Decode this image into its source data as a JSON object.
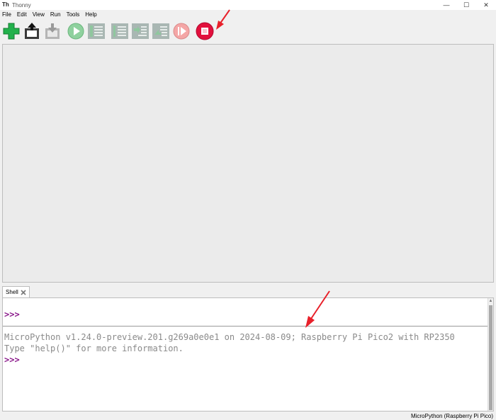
{
  "window": {
    "title": "Thonny",
    "app_icon_text": "Th",
    "controls": {
      "minimize": "—",
      "maximize": "☐",
      "close": "✕"
    }
  },
  "menu": [
    {
      "label": "File"
    },
    {
      "label": "Edit"
    },
    {
      "label": "View"
    },
    {
      "label": "Run"
    },
    {
      "label": "Tools"
    },
    {
      "label": "Help"
    }
  ],
  "toolbar": {
    "buttons": [
      {
        "name": "new-file",
        "icon": "plus-icon",
        "color": "#22b14c"
      },
      {
        "name": "open-file",
        "icon": "open-icon"
      },
      {
        "name": "save-file",
        "icon": "save-icon"
      },
      {
        "name": "run",
        "icon": "play-icon",
        "color": "#8fd19e"
      },
      {
        "name": "debug",
        "icon": "debug-icon"
      },
      {
        "name": "step-over",
        "icon": "step-over-icon"
      },
      {
        "name": "step-into",
        "icon": "step-into-icon"
      },
      {
        "name": "step-out",
        "icon": "step-out-icon"
      },
      {
        "name": "resume",
        "icon": "resume-icon",
        "color": "#f4a6a6"
      },
      {
        "name": "stop",
        "icon": "stop-icon",
        "color": "#e2103d"
      }
    ]
  },
  "shell": {
    "tab_label": "Shell",
    "prompt_1": ">>>",
    "banner_line_1": "MicroPython v1.24.0-preview.201.g269a0e0e1 on 2024-08-09; Raspberry Pi Pico2 with RP2350",
    "banner_line_2": "Type \"help()\" for more information.",
    "prompt_2": ">>>"
  },
  "status": {
    "interpreter": "MicroPython (Raspberry Pi Pico)"
  },
  "colors": {
    "prompt": "#8b1a8b",
    "annotation_arrow": "#e8202a"
  }
}
